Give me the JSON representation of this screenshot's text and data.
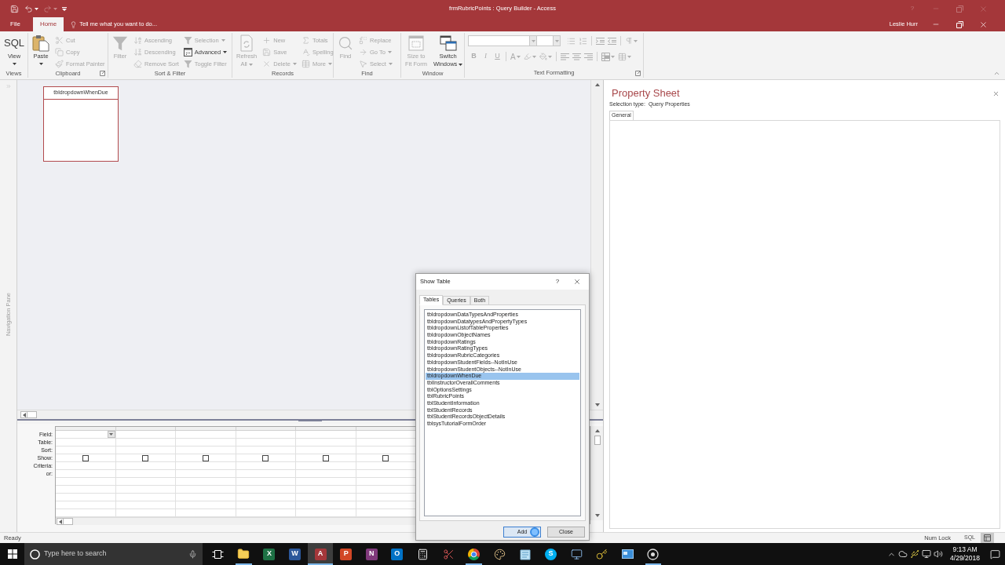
{
  "window": {
    "title": "frmRubricPoints : Query Builder - Access",
    "help": "?",
    "user": "Leslie Hurr"
  },
  "quick_access": [
    {
      "kind": "save",
      "disabled": false
    },
    {
      "kind": "undo",
      "disabled": false
    },
    {
      "kind": "redo",
      "disabled": true
    },
    {
      "kind": "customize",
      "disabled": false
    }
  ],
  "ribbon_tabs": [
    {
      "label": "File",
      "selected": false
    },
    {
      "label": "Home",
      "selected": true
    }
  ],
  "tell_me": {
    "placeholder": "Tell me what you want to do..."
  },
  "ribbon": {
    "groups": [
      {
        "label": "Views",
        "launcher": false,
        "large": [
          {
            "glyph": "SQL",
            "lines": [
              "View"
            ],
            "disabled": false,
            "dropdown": true
          }
        ]
      },
      {
        "label": "Clipboard",
        "launcher": true,
        "large": [
          {
            "lines": [
              "Paste"
            ],
            "disabled": false,
            "dropdown": true
          }
        ],
        "columns": [
          [
            {
              "label": "Cut",
              "disabled": true,
              "dropdown": false
            },
            {
              "label": "Copy",
              "disabled": true,
              "dropdown": false
            },
            {
              "label": "Format Painter",
              "disabled": true,
              "dropdown": false
            }
          ]
        ]
      },
      {
        "label": "Sort & Filter",
        "launcher": false,
        "large": [
          {
            "lines": [
              "Filter"
            ],
            "disabled": true,
            "dropdown": false
          }
        ],
        "columns": [
          [
            {
              "label": "Ascending",
              "disabled": true,
              "dropdown": false
            },
            {
              "label": "Descending",
              "disabled": true,
              "dropdown": false
            },
            {
              "label": "Remove Sort",
              "disabled": true,
              "dropdown": false
            }
          ],
          [
            {
              "label": "Selection",
              "disabled": true,
              "dropdown": true
            },
            {
              "label": "Advanced",
              "disabled": false,
              "dropdown": true
            },
            {
              "label": "Toggle Filter",
              "disabled": true,
              "dropdown": false
            }
          ]
        ]
      },
      {
        "label": "Records",
        "launcher": false,
        "large": [
          {
            "lines": [
              "Refresh",
              "All"
            ],
            "disabled": true,
            "dropdown": true
          }
        ],
        "columns": [
          [
            {
              "label": "New",
              "disabled": true,
              "dropdown": false
            },
            {
              "label": "Save",
              "disabled": true,
              "dropdown": false
            },
            {
              "label": "Delete",
              "disabled": true,
              "dropdown": true
            }
          ],
          [
            {
              "label": "Totals",
              "disabled": true,
              "dropdown": false
            },
            {
              "label": "Spelling",
              "disabled": true,
              "dropdown": false
            },
            {
              "label": "More",
              "disabled": true,
              "dropdown": true
            }
          ]
        ]
      },
      {
        "label": "Find",
        "launcher": false,
        "large": [
          {
            "lines": [
              "Find"
            ],
            "disabled": true,
            "dropdown": false
          }
        ],
        "columns": [
          [
            {
              "label": "Replace",
              "disabled": true,
              "dropdown": false
            },
            {
              "label": "Go To",
              "disabled": true,
              "dropdown": true
            },
            {
              "label": "Select",
              "disabled": true,
              "dropdown": true
            }
          ]
        ]
      },
      {
        "label": "Window",
        "launcher": false,
        "large": [
          {
            "lines": [
              "Size to",
              "Fit Form"
            ],
            "disabled": true,
            "dropdown": false
          },
          {
            "lines": [
              "Switch",
              "Windows"
            ],
            "disabled": false,
            "dropdown": true
          }
        ]
      }
    ],
    "text_formatting": {
      "label": "Text Formatting",
      "launcher": true,
      "disabled": true,
      "style_buttons": [
        {
          "label": "B"
        },
        {
          "label": "I"
        },
        {
          "label": "U"
        }
      ],
      "font_color": {
        "label": "A"
      }
    }
  },
  "design_view": {
    "navigation_pane": {
      "label": "Navigation Pane"
    },
    "tables": [
      {
        "name": "tbldropdownWhenDue"
      }
    ],
    "grid": {
      "rows": [
        {
          "label": "Field:",
          "kind": "field"
        },
        {
          "label": "Table:",
          "kind": "text"
        },
        {
          "label": "Sort:",
          "kind": "text"
        },
        {
          "label": "Show:",
          "kind": "checkbox"
        },
        {
          "label": "Criteria:",
          "kind": "text"
        },
        {
          "label": "or:",
          "kind": "text"
        }
      ],
      "columns": [
        {
          "selected": true,
          "show": false
        },
        {
          "selected": false,
          "show": false
        },
        {
          "selected": false,
          "show": false
        },
        {
          "selected": false,
          "show": false
        },
        {
          "selected": false,
          "show": false
        },
        {
          "selected": false,
          "show": false
        }
      ]
    }
  },
  "property_sheet": {
    "title": "Property Sheet",
    "selection_type_label": "Selection type:",
    "selection_type": "Query Properties",
    "tabs": [
      {
        "label": "General",
        "selected": true
      }
    ]
  },
  "status_bar": {
    "text": "Ready",
    "indicators": [
      "Num Lock"
    ],
    "views": [
      {
        "kind": "sql",
        "label": "SQL",
        "selected": false
      },
      {
        "kind": "design",
        "selected": true
      }
    ]
  },
  "taskbar": {
    "search": {
      "placeholder": "Type here to search"
    },
    "apps": [
      {
        "kind": "folder",
        "running": true,
        "active": false
      },
      {
        "kind": "tile",
        "glyph": "X",
        "color": "#1e7145",
        "running": false,
        "active": false
      },
      {
        "kind": "tile",
        "glyph": "W",
        "color": "#2b579a",
        "running": false,
        "active": false
      },
      {
        "kind": "tile",
        "glyph": "A",
        "color": "#a4373a",
        "running": true,
        "active": true
      },
      {
        "kind": "tile",
        "glyph": "P",
        "color": "#d24726",
        "running": false,
        "active": false
      },
      {
        "kind": "tile",
        "glyph": "N",
        "color": "#80397b",
        "running": false,
        "active": false
      },
      {
        "kind": "tile",
        "glyph": "O",
        "color": "#0072c6",
        "running": false,
        "active": false
      },
      {
        "kind": "calculator",
        "running": false,
        "active": false
      },
      {
        "kind": "scissors",
        "running": false,
        "active": false
      },
      {
        "kind": "browser",
        "running": true,
        "active": false
      },
      {
        "kind": "palette",
        "running": false,
        "active": false
      },
      {
        "kind": "notepad",
        "running": false,
        "active": false
      },
      {
        "kind": "round",
        "glyph": "S",
        "color": "#00aff0",
        "running": false,
        "active": false
      },
      {
        "kind": "computer",
        "running": false,
        "active": false
      },
      {
        "kind": "key",
        "running": false,
        "active": false
      },
      {
        "kind": "window",
        "running": false,
        "active": false
      },
      {
        "kind": "record",
        "running": true,
        "active": false
      }
    ],
    "time": "9:13 AM",
    "date": "4/29/2018"
  },
  "show_table_dialog": {
    "title": "Show Table",
    "help": "?",
    "tabs": [
      {
        "label": "Tables",
        "selected": true
      },
      {
        "label": "Queries",
        "selected": false
      },
      {
        "label": "Both",
        "selected": false
      }
    ],
    "items": [
      {
        "name": "tbldropdownDataTypesAndProperties",
        "selected": false
      },
      {
        "name": "tbldropdownDatatypesAndPropertyTypes",
        "selected": false
      },
      {
        "name": "tbldropdownListofTableProperties",
        "selected": false
      },
      {
        "name": "tbldropdownObjectNames",
        "selected": false
      },
      {
        "name": "tbldropdownRatings",
        "selected": false
      },
      {
        "name": "tbldropdownRatingTypes",
        "selected": false
      },
      {
        "name": "tbldropdownRubricCategories",
        "selected": false
      },
      {
        "name": "tbldropdownStudentFields--NotInUse",
        "selected": false
      },
      {
        "name": "tbldropdownStudentObjects--NotInUse",
        "selected": false
      },
      {
        "name": "tbldropdownWhenDue",
        "selected": true
      },
      {
        "name": "tblInstructorOverallComments",
        "selected": false
      },
      {
        "name": "tblOptionsSettings",
        "selected": false
      },
      {
        "name": "tblRubricPoints",
        "selected": false
      },
      {
        "name": "tblStudentInformation",
        "selected": false
      },
      {
        "name": "tblStudentRecords",
        "selected": false
      },
      {
        "name": "tblStudentRecordsObjectDetails",
        "selected": false
      },
      {
        "name": "tblsysTutorialFormOrder",
        "selected": false
      }
    ],
    "buttons": [
      {
        "label": "Add",
        "focused": true
      },
      {
        "label": "Close",
        "focused": false
      }
    ]
  }
}
